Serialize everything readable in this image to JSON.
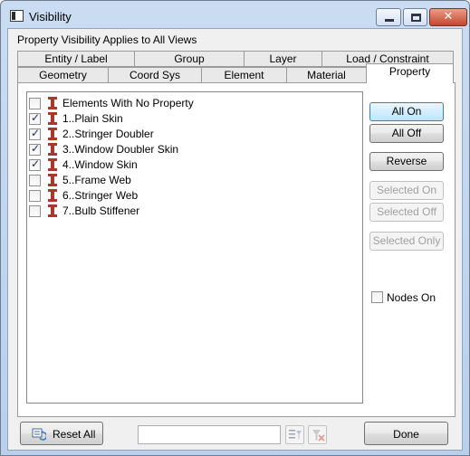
{
  "window": {
    "title": "Visibility",
    "icon": "window-app-icon",
    "controls": {
      "minimize": "minimize-icon",
      "maximize": "maximize-icon",
      "close_glyph": "✕"
    }
  },
  "subtitle": "Property Visibility Applies to All Views",
  "tabs_row1": [
    {
      "label": "Entity / Label"
    },
    {
      "label": "Group"
    },
    {
      "label": "Layer"
    },
    {
      "label": "Load / Constraint"
    }
  ],
  "tabs_row2": [
    {
      "label": "Geometry"
    },
    {
      "label": "Coord Sys"
    },
    {
      "label": "Element"
    },
    {
      "label": "Material"
    },
    {
      "label": "Property",
      "active": true
    }
  ],
  "list": {
    "item_icon": "i-beam-icon",
    "icon_color": "#a8382c",
    "items": [
      {
        "label": "Elements With No Property",
        "checked": false
      },
      {
        "label": "1..Plain Skin",
        "checked": true
      },
      {
        "label": "2..Stringer Doubler",
        "checked": true
      },
      {
        "label": "3..Window Doubler Skin",
        "checked": true
      },
      {
        "label": "4..Window Skin",
        "checked": true
      },
      {
        "label": "5..Frame Web",
        "checked": false
      },
      {
        "label": "6..Stringer Web",
        "checked": false
      },
      {
        "label": "7..Bulb Stiffener",
        "checked": false
      }
    ]
  },
  "buttons": {
    "all_on": "All On",
    "all_off": "All Off",
    "reverse": "Reverse",
    "selected_on": "Selected On",
    "selected_off": "Selected Off",
    "selected_only": "Selected Only"
  },
  "nodes_on": {
    "label": "Nodes On",
    "checked": false
  },
  "footer": {
    "reset_all": "Reset All",
    "filter_value": "",
    "done": "Done"
  },
  "colors": {
    "accent_border": "#3c7fb1",
    "close_button": "#c7442a"
  }
}
